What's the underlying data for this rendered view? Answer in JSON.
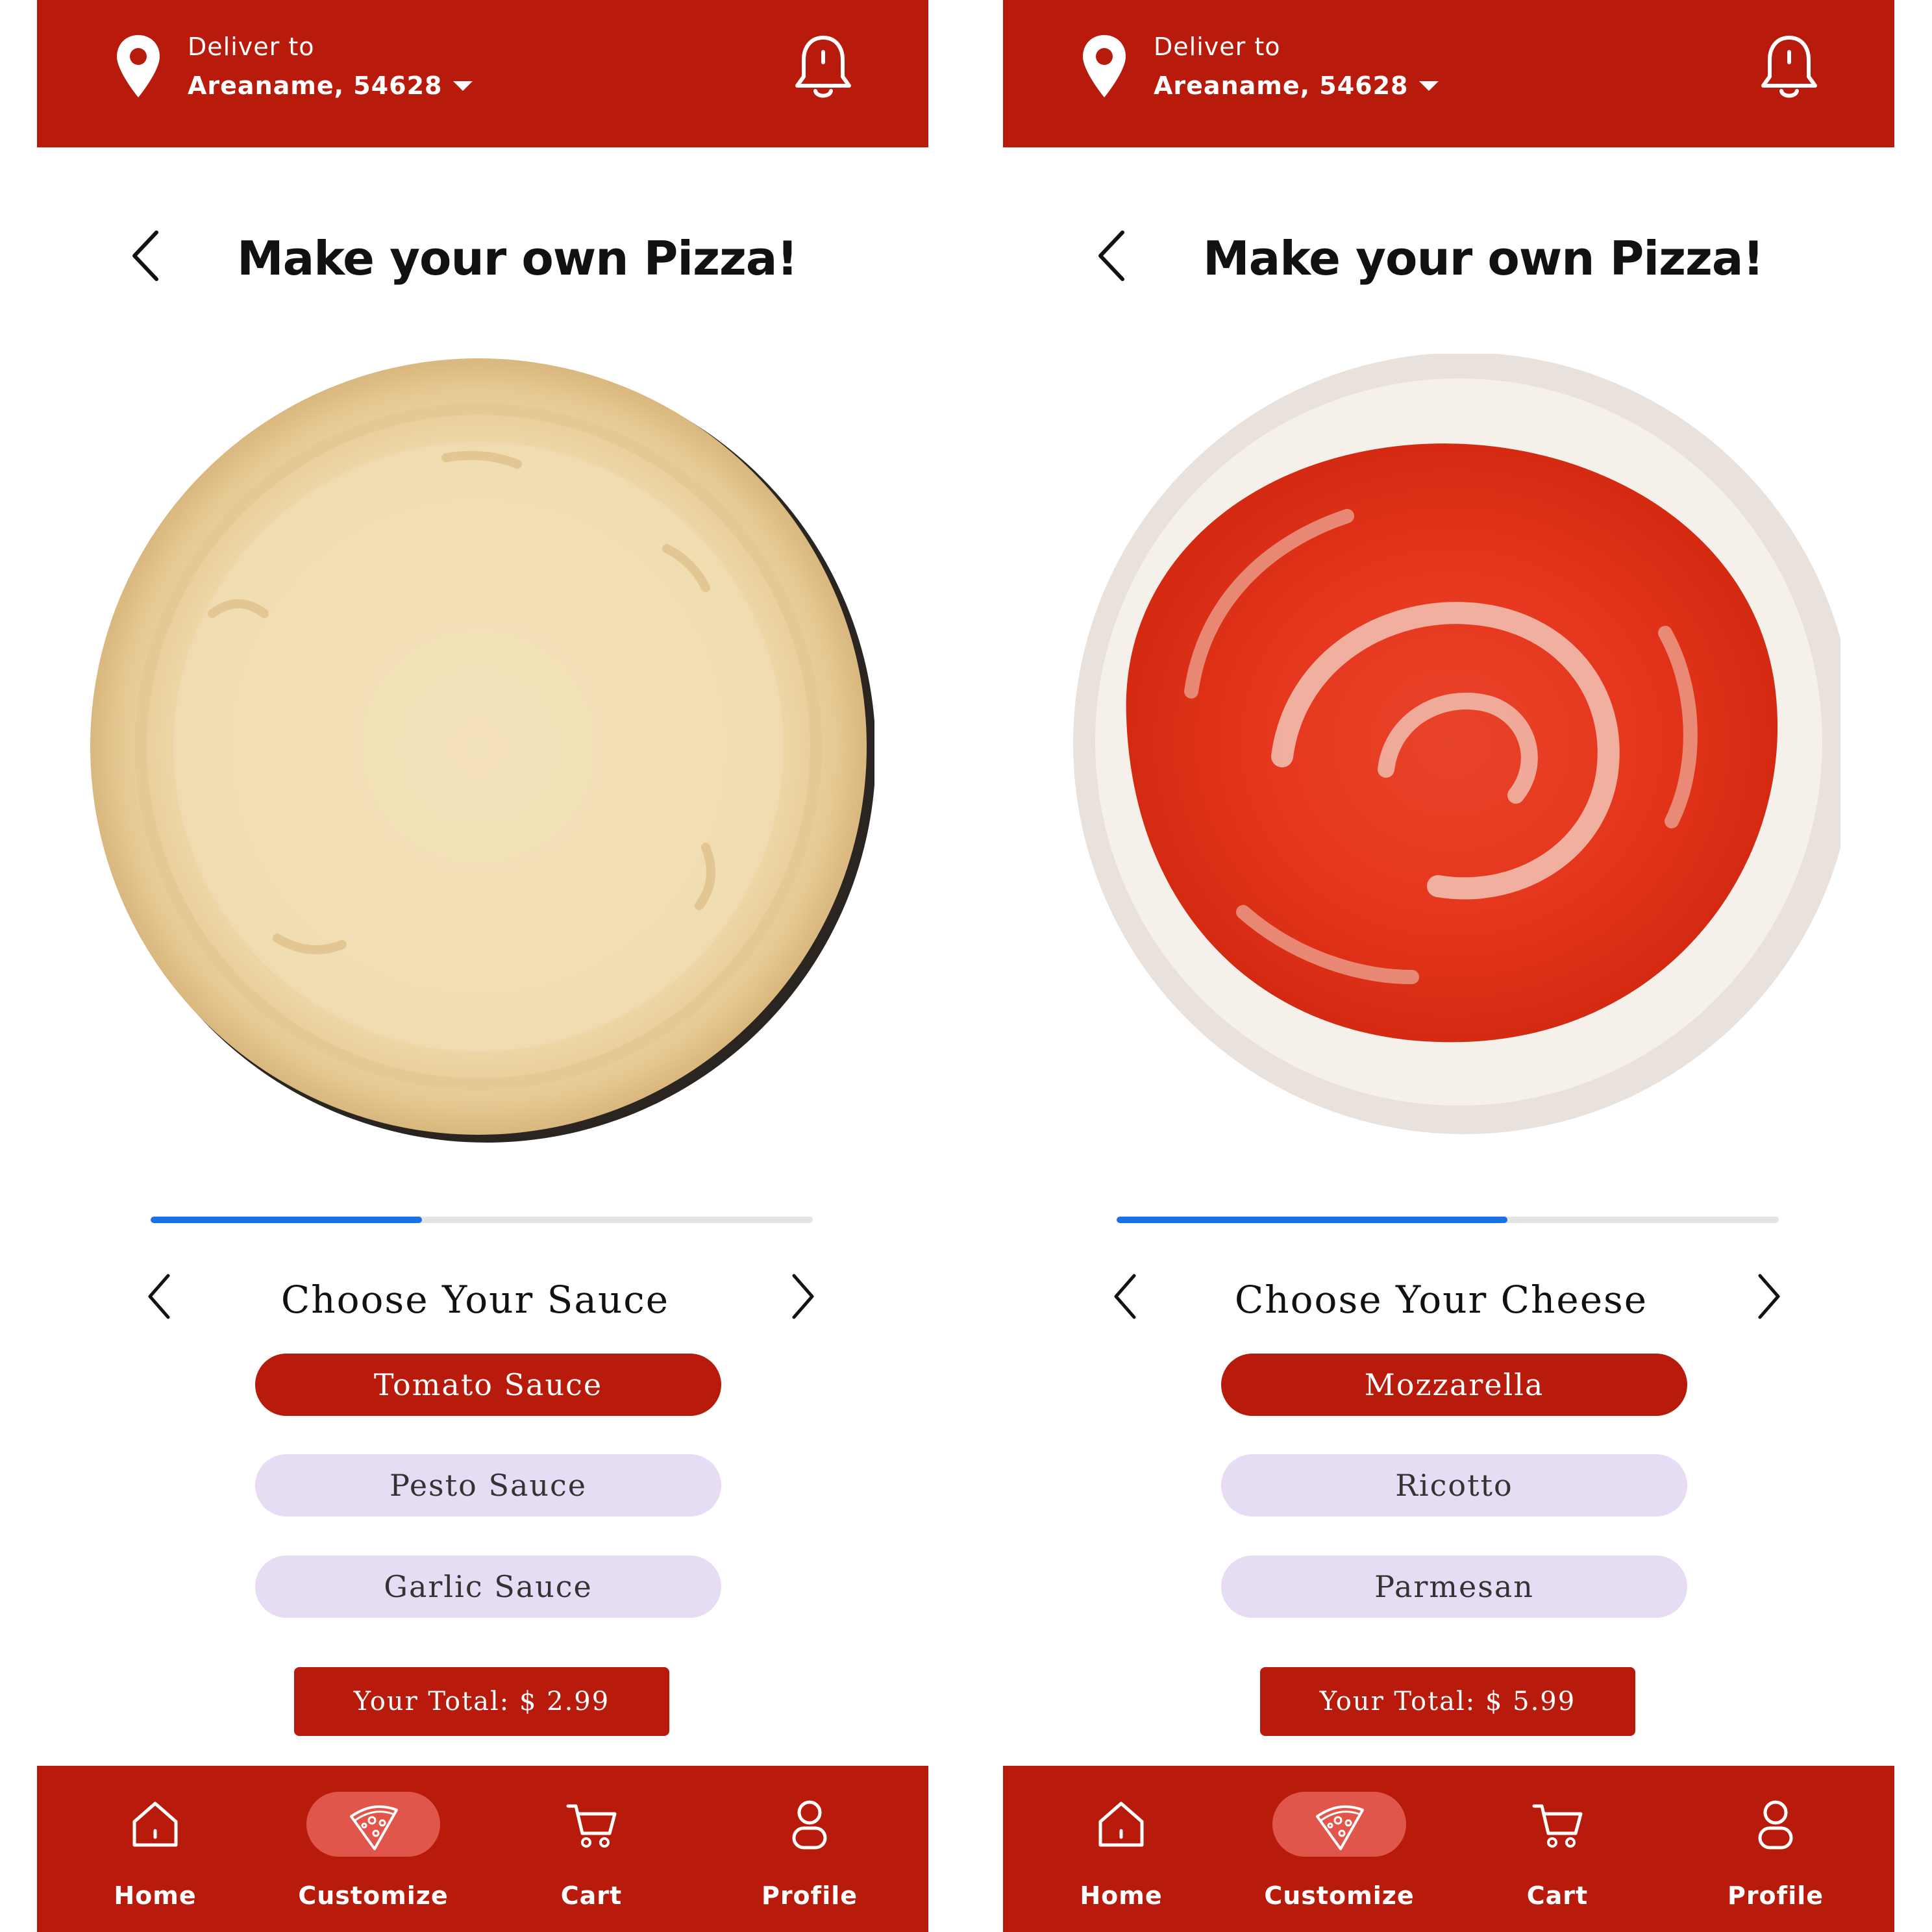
{
  "colors": {
    "brand_red": "#B81B0B",
    "progress_blue": "#1672E6",
    "option_unselected": "#E6DCF4",
    "nav_active_pill": "#E0564A"
  },
  "screens": [
    {
      "header": {
        "deliver_label": "Deliver to",
        "address": "Areaname, 54628",
        "pin_icon": "location-pin-icon",
        "bell_icon": "bell-icon"
      },
      "title": "Make your own Pizza!",
      "pizza_image": "pizza-dough",
      "progress": 0.41,
      "section_title": "Choose Your Sauce",
      "options": [
        {
          "label": "Tomato Sauce",
          "selected": true
        },
        {
          "label": "Pesto Sauce",
          "selected": false
        },
        {
          "label": "Garlic Sauce",
          "selected": false
        }
      ],
      "total": "Your Total: $ 2.99",
      "nav": [
        {
          "label": "Home",
          "icon": "home-icon",
          "active": false
        },
        {
          "label": "Customize",
          "icon": "pizza-slice-icon",
          "active": true
        },
        {
          "label": "Cart",
          "icon": "cart-icon",
          "active": false
        },
        {
          "label": "Profile",
          "icon": "profile-icon",
          "active": false
        }
      ]
    },
    {
      "header": {
        "deliver_label": "Deliver to",
        "address": "Areaname, 54628",
        "pin_icon": "location-pin-icon",
        "bell_icon": "bell-icon"
      },
      "title": "Make your own Pizza!",
      "pizza_image": "pizza-with-tomato-sauce",
      "progress": 0.59,
      "section_title": "Choose Your Cheese",
      "options": [
        {
          "label": "Mozzarella",
          "selected": true
        },
        {
          "label": "Ricotto",
          "selected": false
        },
        {
          "label": "Parmesan",
          "selected": false
        }
      ],
      "total": "Your Total: $ 5.99",
      "nav": [
        {
          "label": "Home",
          "icon": "home-icon",
          "active": false
        },
        {
          "label": "Customize",
          "icon": "pizza-slice-icon",
          "active": true
        },
        {
          "label": "Cart",
          "icon": "cart-icon",
          "active": false
        },
        {
          "label": "Profile",
          "icon": "profile-icon",
          "active": false
        }
      ]
    }
  ]
}
